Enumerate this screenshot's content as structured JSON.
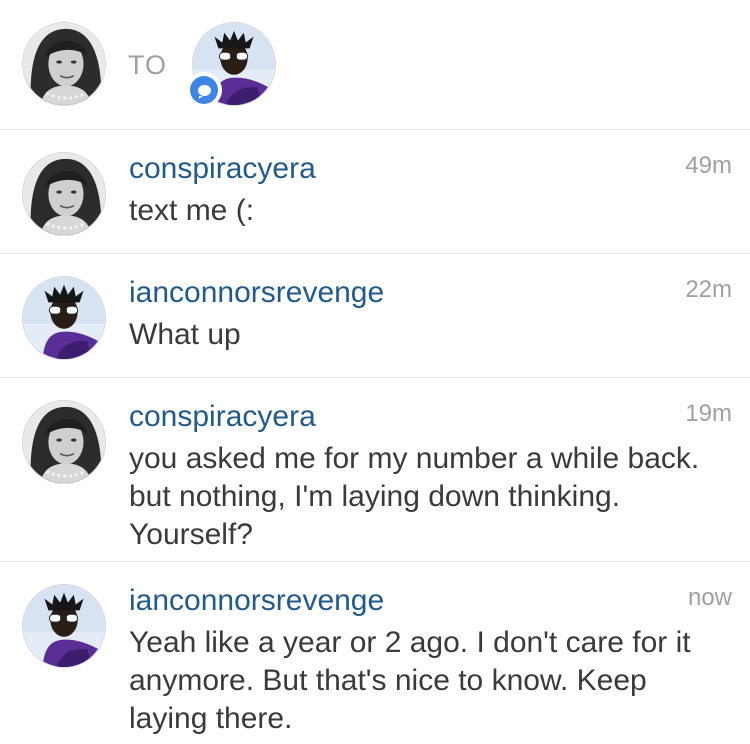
{
  "header": {
    "to_label": "TO",
    "sender_avatar": "woman-avatar",
    "recipient_avatar": "man-avatar",
    "badge_icon": "direct-message-icon",
    "accent_color": "#3d86e6"
  },
  "messages": [
    {
      "username": "conspiracyera",
      "time": "49m",
      "text": "text me (:",
      "avatar": "woman-avatar"
    },
    {
      "username": "ianconnorsrevenge",
      "time": "22m",
      "text": "What up",
      "avatar": "man-avatar"
    },
    {
      "username": "conspiracyera",
      "time": "19m",
      "text": "you asked me for my number a while back. but nothing, I'm laying down thinking. Yourself?",
      "avatar": "woman-avatar"
    },
    {
      "username": "ianconnorsrevenge",
      "time": "now",
      "text": "Yeah like a year or 2 ago. I don't care for it anymore. But that's nice to know. Keep laying there.",
      "avatar": "man-avatar"
    }
  ],
  "colors": {
    "username": "#215b8e",
    "timestamp": "#a0a0a0",
    "divider": "#e6e6e6"
  }
}
